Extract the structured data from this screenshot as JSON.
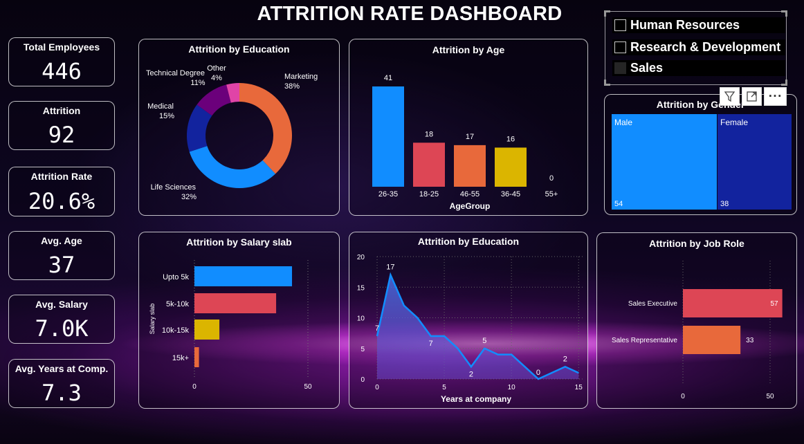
{
  "title": "ATTRITION RATE DASHBOARD",
  "kpis": [
    {
      "label": "Total Employees",
      "value": "446"
    },
    {
      "label": "Attrition",
      "value": "92"
    },
    {
      "label": "Attrition Rate",
      "value": "20.6%"
    },
    {
      "label": "Avg. Age",
      "value": "37"
    },
    {
      "label": "Avg. Salary",
      "value": "7.0K"
    },
    {
      "label": "Avg. Years at Comp.",
      "value": "7.3"
    }
  ],
  "slicer": {
    "items": [
      {
        "label": "Human Resources",
        "selected": false
      },
      {
        "label": "Research & Development",
        "selected": false
      },
      {
        "label": "Sales",
        "selected": true
      }
    ]
  },
  "toolbar": {
    "filter_icon": "filter-icon",
    "focus_icon": "focus-mode-icon",
    "more_icon": "more-options-icon",
    "more_label": "···"
  },
  "colors": {
    "blue": "#118dff",
    "red": "#dd4655",
    "orange": "#e8693b",
    "yellow": "#dbb500",
    "navy": "#12239e",
    "darkblue": "#1638b8",
    "purple": "#6b007b",
    "pink": "#e044a7"
  },
  "chart_data": [
    {
      "id": "education_donut",
      "type": "pie",
      "title": "Attrition by Education",
      "slices": [
        {
          "label": "Marketing",
          "pct": "38%",
          "value": 38,
          "color": "#e8693b"
        },
        {
          "label": "Life Sciences",
          "pct": "32%",
          "value": 32,
          "color": "#118dff"
        },
        {
          "label": "Medical",
          "pct": "15%",
          "value": 15,
          "color": "#12239e"
        },
        {
          "label": "Technical Degree",
          "pct": "11%",
          "value": 11,
          "color": "#6b007b"
        },
        {
          "label": "Other",
          "pct": "4%",
          "value": 4,
          "color": "#e044a7"
        }
      ]
    },
    {
      "id": "age_bar",
      "type": "bar",
      "title": "Attrition by Age",
      "xlabel": "AgeGroup",
      "categories": [
        "26-35",
        "18-25",
        "46-55",
        "36-45",
        "55+"
      ],
      "values": [
        41,
        18,
        17,
        16,
        0
      ],
      "colors": [
        "#118dff",
        "#dd4655",
        "#e8693b",
        "#dbb500",
        "#118dff"
      ],
      "ylim": [
        0,
        41
      ]
    },
    {
      "id": "gender_treemap",
      "type": "bar",
      "title": "Attrition by Gender",
      "categories": [
        "Male",
        "Female"
      ],
      "values": [
        54,
        38
      ],
      "colors": [
        "#118dff",
        "#12239e"
      ]
    },
    {
      "id": "salary_bar",
      "type": "bar",
      "orientation": "horizontal",
      "title": "Attrition by Salary slab",
      "ylabel": "Salary slab",
      "categories": [
        "Upto 5k",
        "5k-10k",
        "10k-15k",
        "15k+"
      ],
      "values": [
        43,
        36,
        11,
        2
      ],
      "colors": [
        "#118dff",
        "#dd4655",
        "#dbb500",
        "#e8693b"
      ],
      "xticks": [
        0,
        50
      ],
      "xlim": [
        0,
        50
      ]
    },
    {
      "id": "years_area",
      "type": "area",
      "title": "Attrition by Education",
      "xlabel": "Years at company",
      "x": [
        0,
        1,
        2,
        3,
        4,
        5,
        6,
        7,
        8,
        9,
        10,
        11,
        12,
        13,
        14,
        15
      ],
      "y": [
        7,
        17,
        12,
        10,
        7,
        7,
        5,
        2,
        5,
        4,
        4,
        2,
        0,
        1,
        2,
        1
      ],
      "labels": [
        {
          "x": 0,
          "y": 7,
          "text": "7"
        },
        {
          "x": 1,
          "y": 17,
          "text": "17"
        },
        {
          "x": 4,
          "y": 7,
          "text": "7"
        },
        {
          "x": 7,
          "y": 2,
          "text": "2"
        },
        {
          "x": 8,
          "y": 5,
          "text": "5"
        },
        {
          "x": 12,
          "y": 0,
          "text": "0"
        },
        {
          "x": 14,
          "y": 2,
          "text": "2"
        }
      ],
      "xticks": [
        0,
        5,
        10,
        15
      ],
      "yticks": [
        0,
        5,
        10,
        15,
        20
      ],
      "xlim": [
        0,
        15.4
      ],
      "ylim": [
        0,
        20
      ],
      "color": "#118dff"
    },
    {
      "id": "jobrole_bar",
      "type": "bar",
      "orientation": "horizontal",
      "title": "Attrition by Job Role",
      "categories": [
        "Sales Executive",
        "Sales Representative"
      ],
      "values": [
        57,
        33
      ],
      "colors": [
        "#dd4655",
        "#e8693b"
      ],
      "xticks": [
        0,
        50
      ],
      "xlim": [
        0,
        57
      ]
    }
  ]
}
